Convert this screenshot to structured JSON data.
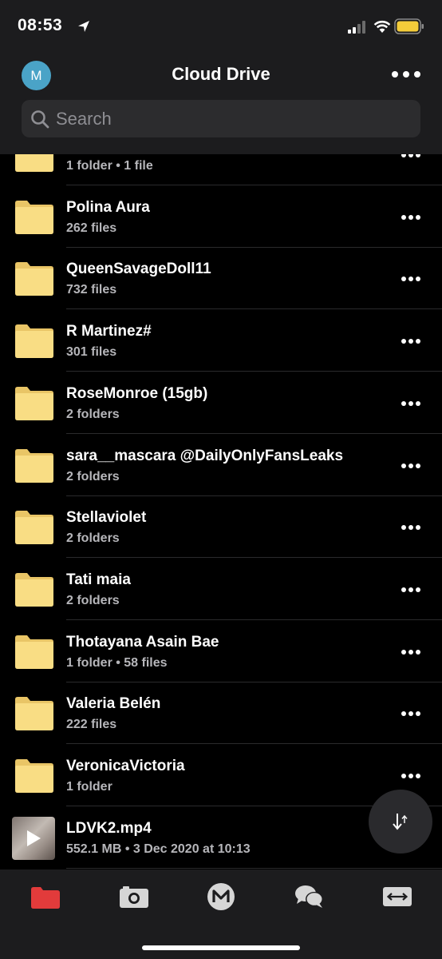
{
  "status_bar": {
    "time": "08:53"
  },
  "header": {
    "avatar_letter": "M",
    "title": "Cloud Drive",
    "search_placeholder": "Search"
  },
  "colors": {
    "folder": "#f9dd84",
    "folder_dark": "#e9c566",
    "active_tab": "#e23b3b",
    "accent": "#4aa3c7"
  },
  "items": [
    {
      "type": "folder",
      "name": "",
      "meta": "1 folder • 1 file"
    },
    {
      "type": "folder",
      "name": "Polina Aura",
      "meta": "262 files"
    },
    {
      "type": "folder",
      "name": "QueenSavageDoll11",
      "meta": "732 files"
    },
    {
      "type": "folder",
      "name": "R Martinez#",
      "meta": "301 files"
    },
    {
      "type": "folder",
      "name": "RoseMonroe (15gb)",
      "meta": "2 folders"
    },
    {
      "type": "folder",
      "name": "sara__mascara @DailyOnlyFansLeaks",
      "meta": "2 folders"
    },
    {
      "type": "folder",
      "name": "Stellaviolet",
      "meta": "2 folders"
    },
    {
      "type": "folder",
      "name": "Tati maia",
      "meta": "2 folders"
    },
    {
      "type": "folder",
      "name": "Thotayana  Asain Bae",
      "meta": "1 folder • 58 files"
    },
    {
      "type": "folder",
      "name": "Valeria Belén",
      "meta": "222 files"
    },
    {
      "type": "folder",
      "name": "VeronicaVictoria",
      "meta": "1 folder"
    },
    {
      "type": "video",
      "name": "LDVK2.mp4",
      "meta": "552.1 MB • 3 Dec 2020 at 10:13"
    }
  ],
  "tabbar": {
    "tabs": [
      {
        "id": "cloud-drive",
        "icon": "folder-icon",
        "active": true
      },
      {
        "id": "camera-uploads",
        "icon": "camera-icon",
        "active": false
      },
      {
        "id": "home",
        "icon": "mega-logo-icon",
        "active": false
      },
      {
        "id": "chat",
        "icon": "chat-icon",
        "active": false
      },
      {
        "id": "transfers",
        "icon": "transfers-icon",
        "active": false
      }
    ]
  }
}
